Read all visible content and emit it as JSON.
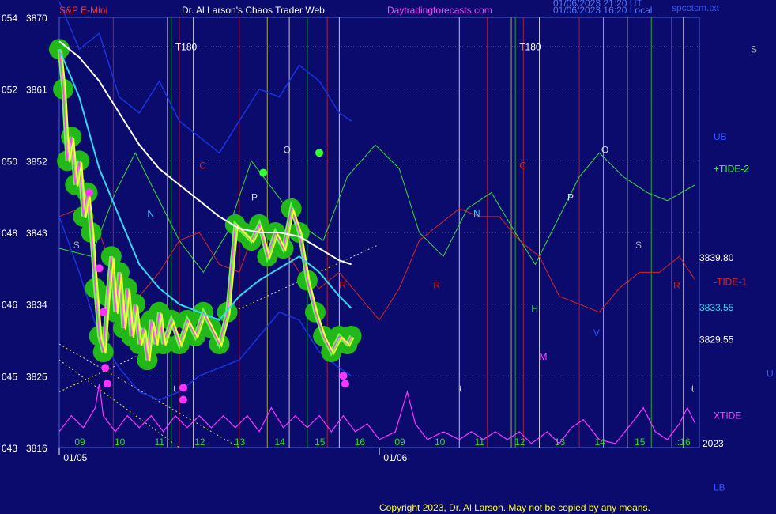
{
  "header": {
    "symbol": "S&P E-Mini",
    "source": "Dr. Al Larson's Chaos Trader Web",
    "site": "Daytradingforecasts.com",
    "stamp1": "01/06/2023 21:20 UT",
    "stamp2": "01/06/2023 16:20 Local",
    "file": "spcctcm.txt"
  },
  "footer": {
    "copyright": "Copyright 2023, Dr. Al Larson. May not be copied by any means."
  },
  "colors": {
    "background": "#0b0b6e",
    "price_fill": "#22b81a",
    "price_line": "#ffff33",
    "avg_white": "#ffffff",
    "avg_cyan": "#33d8f0",
    "avg_magenta": "#ff44ff",
    "tide_plus": "#33dd33",
    "tide_minus": "#dd2222",
    "xtide": "#ff33ff",
    "band": "#1a33dd",
    "grid": "#5a6fae"
  },
  "chart_data": {
    "type": "line",
    "ylim": [
      3816,
      3870
    ],
    "y_ticks": [
      {
        "left": "054",
        "right": "3870",
        "value": 3870
      },
      {
        "left": "052",
        "right": "3861",
        "value": 3861
      },
      {
        "left": "050",
        "right": "3852",
        "value": 3852
      },
      {
        "left": "048",
        "right": "3843",
        "value": 3843
      },
      {
        "left": "046",
        "right": "3834",
        "value": 3834
      },
      {
        "left": "045",
        "right": "3825",
        "value": 3825
      },
      {
        "left": "043",
        "right": "3816",
        "value": 3816
      }
    ],
    "hour_labels": [
      {
        "t": 0.5,
        "label": "09"
      },
      {
        "t": 1.5,
        "label": "10"
      },
      {
        "t": 2.5,
        "label": "11"
      },
      {
        "t": 3.5,
        "label": "12"
      },
      {
        "t": 4.5,
        "label": "13"
      },
      {
        "t": 5.5,
        "label": "14"
      },
      {
        "t": 6.5,
        "label": "15"
      },
      {
        "t": 7.5,
        "label": "16"
      },
      {
        "t": 8.5,
        "label": "09"
      },
      {
        "t": 9.5,
        "label": "10"
      },
      {
        "t": 10.5,
        "label": "11"
      },
      {
        "t": 11.5,
        "label": "12"
      },
      {
        "t": 12.5,
        "label": "13"
      },
      {
        "t": 13.5,
        "label": "14"
      },
      {
        "t": 14.5,
        "label": "15"
      },
      {
        "t": 15.5,
        "label": ".:16"
      }
    ],
    "date_labels": [
      {
        "t": 0.5,
        "label": "01/05"
      },
      {
        "t": 8.5,
        "label": "01/06"
      }
    ],
    "year": "2023",
    "price": [
      [
        0,
        3866
      ],
      [
        0.1,
        3861
      ],
      [
        0.2,
        3852
      ],
      [
        0.3,
        3855
      ],
      [
        0.4,
        3849
      ],
      [
        0.5,
        3852
      ],
      [
        0.6,
        3845
      ],
      [
        0.7,
        3848
      ],
      [
        0.8,
        3843
      ],
      [
        0.9,
        3836
      ],
      [
        1.0,
        3830
      ],
      [
        1.1,
        3828
      ],
      [
        1.2,
        3835
      ],
      [
        1.3,
        3840
      ],
      [
        1.4,
        3833
      ],
      [
        1.5,
        3838
      ],
      [
        1.6,
        3831
      ],
      [
        1.7,
        3836
      ],
      [
        1.8,
        3830
      ],
      [
        1.9,
        3834
      ],
      [
        2.0,
        3829
      ],
      [
        2.1,
        3831
      ],
      [
        2.2,
        3827
      ],
      [
        2.3,
        3832
      ],
      [
        2.4,
        3829
      ],
      [
        2.5,
        3833
      ],
      [
        2.6,
        3829
      ],
      [
        2.8,
        3832
      ],
      [
        3.0,
        3829
      ],
      [
        3.2,
        3832
      ],
      [
        3.4,
        3830
      ],
      [
        3.6,
        3833
      ],
      [
        3.8,
        3831
      ],
      [
        4.0,
        3829
      ],
      [
        4.2,
        3833
      ],
      [
        4.4,
        3844
      ],
      [
        4.6,
        3843
      ],
      [
        4.8,
        3842
      ],
      [
        5.0,
        3844
      ],
      [
        5.2,
        3840
      ],
      [
        5.4,
        3843
      ],
      [
        5.6,
        3841
      ],
      [
        5.8,
        3846
      ],
      [
        6.0,
        3843
      ],
      [
        6.2,
        3837
      ],
      [
        6.4,
        3833
      ],
      [
        6.6,
        3830
      ],
      [
        6.8,
        3828
      ],
      [
        7.0,
        3830
      ],
      [
        7.2,
        3829
      ],
      [
        7.3,
        3830
      ]
    ],
    "avg_white": [
      [
        0,
        3867
      ],
      [
        0.5,
        3865
      ],
      [
        1.0,
        3862
      ],
      [
        1.5,
        3858
      ],
      [
        2.0,
        3854
      ],
      [
        2.5,
        3851
      ],
      [
        3.0,
        3849
      ],
      [
        3.5,
        3847
      ],
      [
        4.0,
        3845
      ],
      [
        4.5,
        3843.5
      ],
      [
        5.0,
        3843
      ],
      [
        5.5,
        3843
      ],
      [
        6.0,
        3842.5
      ],
      [
        6.5,
        3841
      ],
      [
        7.0,
        3839.5
      ],
      [
        7.3,
        3839
      ]
    ],
    "avg_cyan": [
      [
        0,
        3866
      ],
      [
        0.5,
        3860
      ],
      [
        1.0,
        3851
      ],
      [
        1.5,
        3845
      ],
      [
        2.0,
        3839
      ],
      [
        2.5,
        3836
      ],
      [
        3.0,
        3834
      ],
      [
        3.5,
        3833
      ],
      [
        4.0,
        3832
      ],
      [
        4.5,
        3835
      ],
      [
        5.0,
        3837
      ],
      [
        5.5,
        3838.5
      ],
      [
        6.0,
        3840
      ],
      [
        6.5,
        3838
      ],
      [
        7.0,
        3835
      ],
      [
        7.3,
        3833.5
      ]
    ],
    "tide_plus": [
      [
        0,
        3841
      ],
      [
        0.8,
        3840
      ],
      [
        1.4,
        3848
      ],
      [
        1.9,
        3853
      ],
      [
        2.4,
        3848
      ],
      [
        3.0,
        3842
      ],
      [
        3.6,
        3838
      ],
      [
        4.2,
        3843
      ],
      [
        4.8,
        3852
      ],
      [
        5.4,
        3848
      ],
      [
        6.0,
        3844
      ],
      [
        6.6,
        3842
      ],
      [
        7.2,
        3850
      ],
      [
        7.9,
        3854
      ],
      [
        8.5,
        3851
      ],
      [
        9.0,
        3843
      ],
      [
        9.6,
        3840
      ],
      [
        10.2,
        3846
      ],
      [
        10.8,
        3848
      ],
      [
        11.4,
        3843
      ],
      [
        11.9,
        3839
      ],
      [
        12.5,
        3845
      ],
      [
        13.0,
        3850
      ],
      [
        13.5,
        3853
      ],
      [
        14.1,
        3850
      ],
      [
        14.7,
        3848
      ],
      [
        15.2,
        3847
      ],
      [
        15.9,
        3849
      ]
    ],
    "tide_minus": [
      [
        0,
        3845
      ],
      [
        0.5,
        3846
      ],
      [
        1.0,
        3843
      ],
      [
        1.5,
        3836
      ],
      [
        2.0,
        3835
      ],
      [
        2.5,
        3838
      ],
      [
        3.0,
        3842
      ],
      [
        3.5,
        3843
      ],
      [
        4.0,
        3839
      ],
      [
        4.5,
        3838
      ],
      [
        5.0,
        3845
      ],
      [
        5.5,
        3842
      ],
      [
        6.0,
        3838
      ],
      [
        6.5,
        3836
      ],
      [
        7.0,
        3838
      ],
      [
        7.5,
        3835
      ],
      [
        8.0,
        3832
      ],
      [
        8.5,
        3836
      ],
      [
        9.0,
        3842
      ],
      [
        9.5,
        3844
      ],
      [
        10.0,
        3846
      ],
      [
        10.5,
        3845
      ],
      [
        11.0,
        3845
      ],
      [
        11.5,
        3842
      ],
      [
        12.0,
        3840
      ],
      [
        12.5,
        3835
      ],
      [
        13.0,
        3834
      ],
      [
        13.5,
        3833
      ],
      [
        14.0,
        3836
      ],
      [
        14.5,
        3838
      ],
      [
        15.0,
        3838
      ],
      [
        15.5,
        3840
      ],
      [
        15.9,
        3837
      ]
    ],
    "band_upper": [
      [
        0,
        3872
      ],
      [
        0.5,
        3866
      ],
      [
        1.0,
        3868
      ],
      [
        1.5,
        3860
      ],
      [
        2.0,
        3858
      ],
      [
        2.5,
        3862
      ],
      [
        3.0,
        3857
      ],
      [
        3.5,
        3855
      ],
      [
        4.0,
        3853
      ],
      [
        4.5,
        3857
      ],
      [
        5.0,
        3861
      ],
      [
        5.5,
        3860
      ],
      [
        6.0,
        3864
      ],
      [
        6.5,
        3862
      ],
      [
        7.0,
        3858
      ],
      [
        7.3,
        3857
      ]
    ],
    "band_lower": [
      [
        0,
        3845
      ],
      [
        0.5,
        3838
      ],
      [
        1.0,
        3830
      ],
      [
        1.5,
        3826
      ],
      [
        2.0,
        3823
      ],
      [
        2.5,
        3822
      ],
      [
        3.0,
        3823
      ],
      [
        3.5,
        3825
      ],
      [
        4.0,
        3826
      ],
      [
        4.5,
        3827
      ],
      [
        5.0,
        3830
      ],
      [
        5.5,
        3833
      ],
      [
        6.0,
        3832
      ],
      [
        6.5,
        3828
      ],
      [
        7.0,
        3826
      ],
      [
        7.3,
        3825
      ]
    ],
    "xtide": [
      [
        0,
        3818
      ],
      [
        0.3,
        3820
      ],
      [
        0.6,
        3818.5
      ],
      [
        0.9,
        3821
      ],
      [
        1.0,
        3824
      ],
      [
        1.1,
        3820
      ],
      [
        1.4,
        3818
      ],
      [
        1.7,
        3820
      ],
      [
        2.0,
        3818.5
      ],
      [
        2.3,
        3820
      ],
      [
        2.6,
        3818
      ],
      [
        2.9,
        3820
      ],
      [
        3.2,
        3818.5
      ],
      [
        3.5,
        3820
      ],
      [
        3.8,
        3818.5
      ],
      [
        4.1,
        3820
      ],
      [
        4.4,
        3818.5
      ],
      [
        4.7,
        3820
      ],
      [
        5.0,
        3818
      ],
      [
        5.3,
        3821
      ],
      [
        5.6,
        3818.5
      ],
      [
        5.9,
        3820
      ],
      [
        6.2,
        3818.5
      ],
      [
        6.5,
        3820
      ],
      [
        6.8,
        3818
      ],
      [
        7.1,
        3820
      ],
      [
        7.4,
        3818
      ],
      [
        7.7,
        3819
      ],
      [
        8.0,
        3817
      ],
      [
        8.4,
        3818
      ],
      [
        8.7,
        3823
      ],
      [
        8.9,
        3819
      ],
      [
        9.2,
        3817
      ],
      [
        9.6,
        3818
      ],
      [
        10.0,
        3817
      ],
      [
        10.3,
        3818
      ],
      [
        10.6,
        3817
      ],
      [
        10.9,
        3818
      ],
      [
        11.2,
        3817
      ],
      [
        11.5,
        3818
      ],
      [
        11.8,
        3816.5
      ],
      [
        12.2,
        3818
      ],
      [
        12.5,
        3816.5
      ],
      [
        12.8,
        3818.5
      ],
      [
        13.1,
        3819.5
      ],
      [
        13.5,
        3817
      ],
      [
        13.9,
        3816.5
      ],
      [
        14.3,
        3819
      ],
      [
        14.6,
        3821
      ],
      [
        14.9,
        3818
      ],
      [
        15.2,
        3817
      ],
      [
        15.5,
        3819
      ],
      [
        15.7,
        3821
      ],
      [
        15.9,
        3819
      ]
    ],
    "fan_lines": [
      {
        "from": [
          0.0,
          3829
        ],
        "to": [
          4.5,
          3816
        ]
      },
      {
        "from": [
          0.0,
          3823
        ],
        "to": [
          8.0,
          3841.5
        ]
      },
      {
        "from": [
          0.0,
          3827
        ],
        "to": [
          3.0,
          3816
        ]
      }
    ],
    "vertical_lines": [
      {
        "t": 1.35,
        "color": "#dd2222"
      },
      {
        "t": 2.7,
        "color": "#dddd22"
      },
      {
        "t": 2.8,
        "color": "#22dd22"
      },
      {
        "t": 3.0,
        "color": "#dd2222"
      },
      {
        "t": 3.35,
        "color": "#ffffff"
      },
      {
        "t": 4.5,
        "color": "#dd2222"
      },
      {
        "t": 5.2,
        "color": "#dddd22"
      },
      {
        "t": 5.75,
        "color": "#ffffff"
      },
      {
        "t": 6.2,
        "color": "#22dd22"
      },
      {
        "t": 6.7,
        "color": "#dd2222"
      },
      {
        "t": 7.0,
        "color": "#ffffff"
      },
      {
        "t": 10.0,
        "color": "#ffffff"
      },
      {
        "t": 10.7,
        "color": "#dd2222"
      },
      {
        "t": 11.3,
        "color": "#dddd22"
      },
      {
        "t": 11.4,
        "color": "#22dd22"
      },
      {
        "t": 11.6,
        "color": "#dd2222"
      },
      {
        "t": 12.0,
        "color": "#ffffff"
      },
      {
        "t": 13.0,
        "color": "#dd2222"
      },
      {
        "t": 13.6,
        "color": "#dddd22"
      },
      {
        "t": 14.2,
        "color": "#ffffff"
      },
      {
        "t": 14.8,
        "color": "#22dd22"
      },
      {
        "t": 15.3,
        "color": "#dd2222"
      },
      {
        "t": 15.6,
        "color": "#ffffff"
      }
    ],
    "markers": [
      {
        "t": 0.75,
        "y": 3848
      },
      {
        "t": 1.0,
        "y": 3838.5
      },
      {
        "t": 1.1,
        "y": 3833
      },
      {
        "t": 1.15,
        "y": 3826
      },
      {
        "t": 1.2,
        "y": 3824
      },
      {
        "t": 3.1,
        "y": 3823.5
      },
      {
        "t": 3.1,
        "y": 3822
      },
      {
        "t": 7.1,
        "y": 3825
      },
      {
        "t": 7.15,
        "y": 3824
      },
      {
        "t": 5.1,
        "y": 3850.5
      },
      {
        "t": 6.5,
        "y": 3853
      }
    ],
    "planet_letters": [
      {
        "t": 0.35,
        "y": 3841,
        "text": "S",
        "color": "#aaaaaa"
      },
      {
        "t": 2.2,
        "y": 3845,
        "text": "N",
        "color": "#33ccff"
      },
      {
        "t": 3.5,
        "y": 3851,
        "text": "C",
        "color": "#dd2222"
      },
      {
        "t": 4.8,
        "y": 3847,
        "text": "P",
        "color": "#dddddd"
      },
      {
        "t": 5.6,
        "y": 3853,
        "text": "O",
        "color": "#dddddd"
      },
      {
        "t": 7.0,
        "y": 3836,
        "text": "R",
        "color": "#dd2222"
      },
      {
        "t": 2.85,
        "y": 3823,
        "text": "t",
        "color": "#dddddd"
      },
      {
        "t": 9.35,
        "y": 3836,
        "text": "R",
        "color": "#dd2222"
      },
      {
        "t": 10.0,
        "y": 3823,
        "text": "t",
        "color": "#dddddd"
      },
      {
        "t": 10.35,
        "y": 3845,
        "text": "N",
        "color": "#33ccff"
      },
      {
        "t": 11.5,
        "y": 3851,
        "text": "C",
        "color": "#dd2222"
      },
      {
        "t": 11.8,
        "y": 3833,
        "text": "H",
        "color": "#33ff33"
      },
      {
        "t": 12.0,
        "y": 3827,
        "text": "M",
        "color": "#ff44ff"
      },
      {
        "t": 12.7,
        "y": 3847,
        "text": "P",
        "color": "#dddddd"
      },
      {
        "t": 13.35,
        "y": 3830,
        "text": "V",
        "color": "#3355ff"
      },
      {
        "t": 13.55,
        "y": 3853,
        "text": "O",
        "color": "#dddddd"
      },
      {
        "t": 14.4,
        "y": 3841,
        "text": "S",
        "color": "#aaaaaa"
      },
      {
        "t": 15.35,
        "y": 3836,
        "text": "R",
        "color": "#dd2222"
      },
      {
        "t": 15.8,
        "y": 3823,
        "text": "t",
        "color": "#dddddd"
      }
    ],
    "t180_labels": [
      {
        "t": 2.9,
        "y": 3866.3,
        "text": "T180"
      },
      {
        "t": 11.5,
        "y": 3866.3,
        "text": "T180"
      }
    ],
    "right_labels": [
      {
        "y": 3866,
        "text": "S",
        "color": "#aaaaaa"
      },
      {
        "y": 3855,
        "text": "UB",
        "color": "#3355ff"
      },
      {
        "y": 3851,
        "text": "+TIDE-2",
        "color": "#33ff33"
      },
      {
        "y": 3839.8,
        "text": "3839.80",
        "color": "#ffffff"
      },
      {
        "y": 3836.8,
        "text": "-TIDE-1",
        "color": "#dd2222"
      },
      {
        "y": 3833.55,
        "text": "3833.55",
        "color": "#33d8f0"
      },
      {
        "y": 3829.55,
        "text": "3829.55",
        "color": "#ffffff"
      },
      {
        "y": 3825.3,
        "text": "U",
        "color": "#3355ff"
      },
      {
        "y": 3820,
        "text": "XTIDE",
        "color": "#ff44ff"
      },
      {
        "y": 3811,
        "text": "LB",
        "color": "#3355ff"
      }
    ]
  }
}
